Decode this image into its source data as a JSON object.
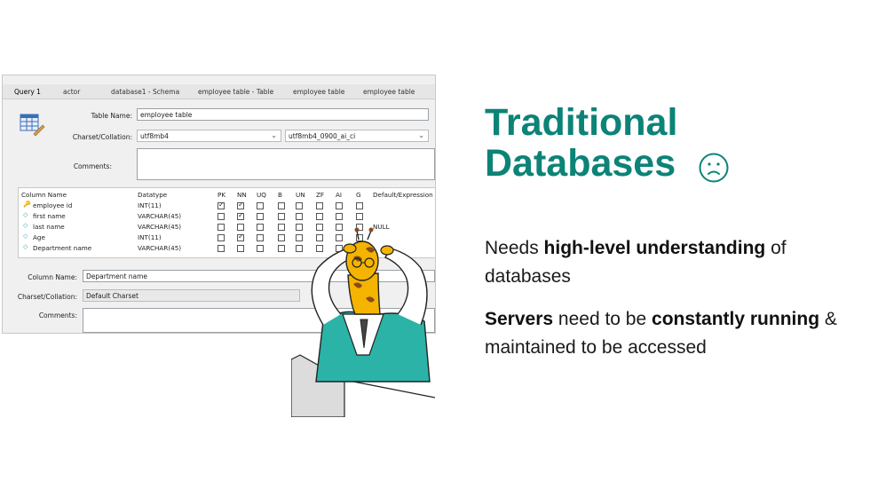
{
  "screenshot": {
    "tabs": [
      "Query 1",
      "actor",
      "database1 - Schema",
      "employee table - Table",
      "employee table",
      "employee table"
    ],
    "table_name_label": "Table Name:",
    "table_name_value": "employee table",
    "charset_label": "Charset/Collation:",
    "charset_value": "utf8mb4",
    "collation_value": "utf8mb4_0900_ai_ci",
    "comments_label": "Comments:",
    "grid_headers": [
      "Column Name",
      "Datatype",
      "PK",
      "NN",
      "UQ",
      "B",
      "UN",
      "ZF",
      "AI",
      "G",
      "Default/Expression"
    ],
    "rows": [
      {
        "name": "employee id",
        "type": "INT(11)",
        "pk": true,
        "nn": true,
        "default": ""
      },
      {
        "name": "first name",
        "type": "VARCHAR(45)",
        "pk": false,
        "nn": true,
        "default": ""
      },
      {
        "name": "last name",
        "type": "VARCHAR(45)",
        "pk": false,
        "nn": false,
        "default": "NULL"
      },
      {
        "name": "Age",
        "type": "INT(11)",
        "pk": false,
        "nn": true,
        "default": ""
      },
      {
        "name": "Department name",
        "type": "VARCHAR(45)",
        "pk": false,
        "nn": false,
        "default": ""
      }
    ],
    "column_name_label": "Column Name:",
    "column_name_value": "Department name",
    "column_charset_label": "Charset/Collation:",
    "column_charset_value": "Default Charset",
    "column_comments_label": "Comments:"
  },
  "slide": {
    "title_line1": "Traditional",
    "title_line2": "Databases",
    "face_icon": "frown-icon",
    "p1_a": "Needs ",
    "p1_b": "high-level understanding",
    "p1_c": " of databases",
    "p2_a": "Servers",
    "p2_b": " need to be ",
    "p2_c": "constantly running",
    "p2_d": " & maintained to be accessed"
  },
  "colors": {
    "accent": "#0c8377",
    "tab_accent": "#1f64b8",
    "giraffe": "#f4b400",
    "coat": "#2bb3a8"
  }
}
